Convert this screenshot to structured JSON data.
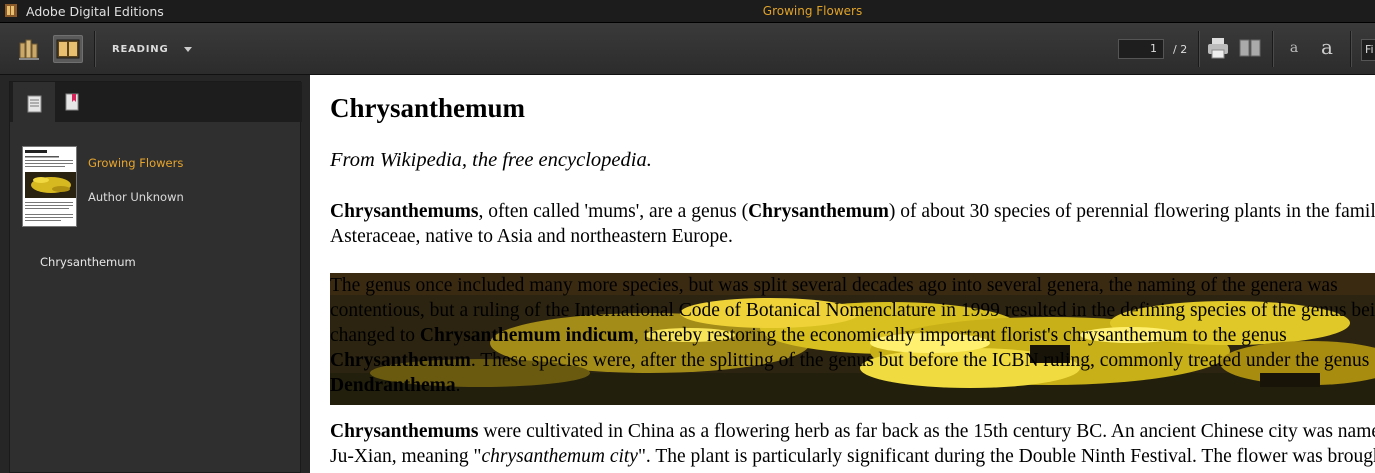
{
  "window": {
    "app_title": "Adobe Digital Editions",
    "document_title": "Growing Flowers"
  },
  "toolbar": {
    "mode_label": "READING",
    "page_current": "1",
    "page_total": "/ 2",
    "font_decrease_label": "a",
    "font_increase_label": "a",
    "fit_label": "Fi"
  },
  "sidebar": {
    "book": {
      "title": "Growing Flowers",
      "author": "Author Unknown"
    },
    "toc": [
      "Chrysanthemum"
    ]
  },
  "content": {
    "heading": "Chrysanthemum",
    "subtitle": "From Wikipedia, the free encyclopedia.",
    "p1": {
      "b1": "Chrysanthemums",
      "t1": ", often called 'mums', are a genus (",
      "b2": "Chrysanthemum",
      "t2": ") of about 30 species of perennial flowering plants in the family",
      "line2": "Asteraceae, native to Asia and northeastern Europe."
    },
    "p2": {
      "line1": "The genus once included many more species, but was split several decades ago into several genera, the naming of the genera was",
      "line2": "contentious, but a ruling of the International Code of Botanical Nomenclature in 1999 resulted in the defining species of the genus being",
      "line3_pre": "changed to ",
      "line3_bold": "Chrysanthemum indicum",
      "line3_post": ", thereby restoring the economically important florist's chrysanthemum to the genus",
      "line4_bold": "Chrysanthemum",
      "line4_post": ". These species were, after the splitting of the genus but before the ICBN ruling, commonly treated under the genus",
      "line5_bold": "Dendranthema",
      "line5_post": "."
    },
    "p3": {
      "b1": "Chrysanthemums",
      "t1": " were cultivated in China as a flowering herb as far back as the 15th century BC. An ancient Chinese city was named",
      "line2_pre": "Ju-Xian, meaning \"",
      "line2_italic": "chrysanthemum city",
      "line2_post": "\". The plant is particularly significant during the Double Ninth Festival. The flower was brought to"
    }
  },
  "colors": {
    "accent": "#e8a52c",
    "chrome_dark": "#1c1c1c",
    "toolbar": "#333333",
    "sidebar": "#2f2f2f"
  }
}
